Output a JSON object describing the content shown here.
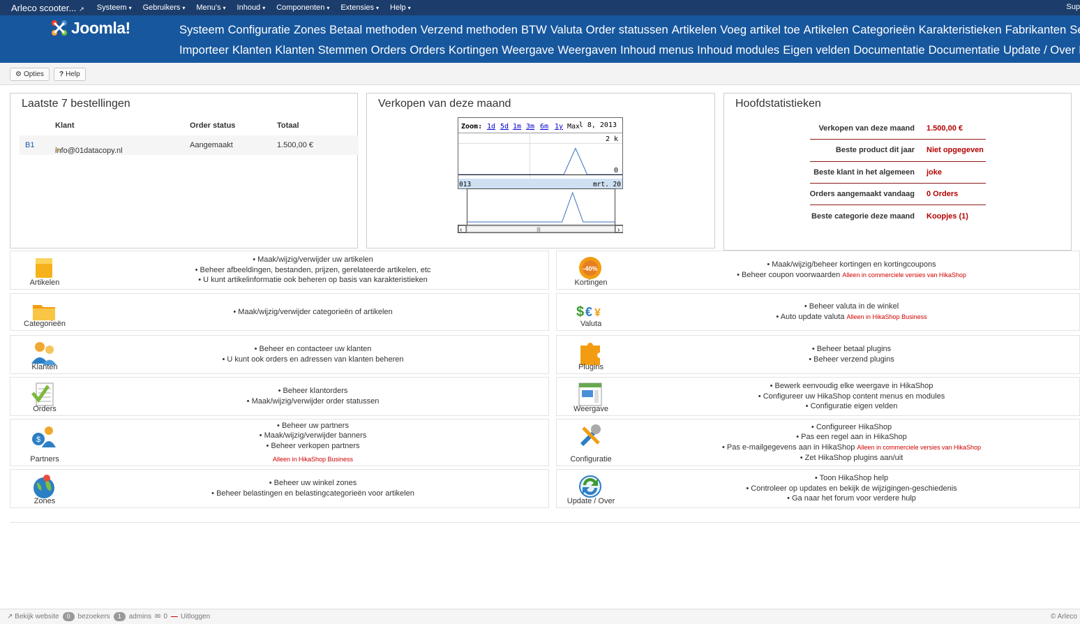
{
  "topbar": {
    "site_title": "Arleco scooter...",
    "menus": [
      "Systeem",
      "Gebruikers",
      "Menu's",
      "Inhoud",
      "Componenten",
      "Extensies",
      "Help"
    ],
    "right": "Sup"
  },
  "header": {
    "logo_text": "Joomla!",
    "nav_row1": [
      "Systeem",
      "Configuratie",
      "Zones",
      "Betaal methoden",
      "Verzend methoden",
      "BTW",
      "Valuta",
      "Order statussen",
      "Artikelen",
      "Voeg artikel toe",
      "Artikelen",
      "Categorieën",
      "Karakteristieken",
      "Fabrikanten",
      "Series"
    ],
    "nav_row2": [
      "Importeer",
      "Klanten",
      "Klanten",
      "Stemmen",
      "Orders",
      "Orders",
      "Kortingen",
      "Weergave",
      "Weergaven",
      "Inhoud menus",
      "Inhoud modules",
      "Eigen velden",
      "Documentatie",
      "Documentatie",
      "Update / Over",
      "Forum"
    ]
  },
  "toolbar": {
    "options": "Opties",
    "help": "Help"
  },
  "orders_panel": {
    "title": "Laatste 7 bestellingen",
    "columns": [
      "Klant",
      "Order status",
      "Totaal"
    ],
    "rows": [
      {
        "id": "B1",
        "customer": "info@01datacopy.nl",
        "status": "Aangemaakt",
        "total": "1.500,00 €"
      }
    ]
  },
  "sales_panel": {
    "title": "Verkopen van deze maand",
    "zoom_label": "Zoom:",
    "zoom_options": [
      "1d",
      "5d",
      "1m",
      "3m",
      "6m",
      "1y",
      "Max"
    ],
    "date_label": "l 8, 2013",
    "y_top": "2 k",
    "y_zero": "0",
    "range_left": "013",
    "range_right": "mrt. 20"
  },
  "chart_data": {
    "type": "line",
    "title": "",
    "ylim": [
      0,
      2000
    ],
    "note_values": "single spike near end of period",
    "series": [
      {
        "values": [
          0,
          0,
          0,
          0,
          0,
          0,
          0,
          0,
          0,
          0,
          1500,
          0,
          0,
          0,
          0
        ]
      }
    ]
  },
  "stats_panel": {
    "title": "Hoofdstatistieken",
    "rows": [
      {
        "label": "Verkopen van deze maand",
        "value": "1.500,00 €"
      },
      {
        "label": "Beste product dit jaar",
        "value": "Niet opgegeven"
      },
      {
        "label": "Beste klant in het algemeen",
        "value": "joke"
      },
      {
        "label": "Orders aangemaakt vandaag",
        "value": "0 Orders"
      },
      {
        "label": "Beste categorie deze maand",
        "value": "Koopjes (1)"
      }
    ]
  },
  "tiles_left": [
    {
      "label": "Artikelen",
      "lines": [
        "Maak/wijzig/verwijder uw artikelen",
        "Beheer afbeeldingen, bestanden, prijzen, gerelateerde artikelen, etc",
        "U kunt artikelinformatie ook beheren op basis van karakteristieken"
      ]
    },
    {
      "label": "Categorieën",
      "lines": [
        "Maak/wijzig/verwijder categorieën of artikelen"
      ]
    },
    {
      "label": "Klanten",
      "lines": [
        "Beheer en contacteer uw klanten",
        "U kunt ook orders en adressen van klanten beheren"
      ]
    },
    {
      "label": "Orders",
      "lines": [
        "Beheer klantorders",
        "Maak/wijzig/verwijder order statussen"
      ]
    },
    {
      "label": "Partners",
      "lines": [
        "Beheer uw partners",
        "Maak/wijzig/verwijder banners",
        "Beheer verkopen partners"
      ],
      "note": "Alleen in HikaShop Business"
    },
    {
      "label": "Zones",
      "lines": [
        "Beheer uw winkel zones",
        "Beheer belastingen en belastingcategorieën voor artikelen"
      ]
    }
  ],
  "tiles_right": [
    {
      "label": "Kortingen",
      "lines": [
        "Maak/wijzig/beheer kortingen en kortingcoupons",
        "Beheer coupon voorwaarden"
      ],
      "inline_notes": {
        "1": "Alleen in commerciele versies van HikaShop"
      }
    },
    {
      "label": "Valuta",
      "lines": [
        "Beheer valuta in de winkel",
        "Auto update valuta"
      ],
      "inline_notes": {
        "1": "Alleen in HikaShop Business"
      }
    },
    {
      "label": "Plugins",
      "lines": [
        "Beheer betaal plugins",
        "Beheer verzend plugins"
      ]
    },
    {
      "label": "Weergave",
      "lines": [
        "Bewerk eenvoudig elke weergave in HikaShop",
        "Configureer uw HikaShop content menus en modules",
        "Configuratie eigen velden"
      ]
    },
    {
      "label": "Configuratie",
      "lines": [
        "Configureer HikaShop",
        "Pas een regel aan in HikaShop",
        "Pas e-mailgegevens aan in HikaShop",
        "Zet HikaShop plugins aan/uit"
      ],
      "inline_notes": {
        "2": "Alleen in commerciele versies van HikaShop"
      }
    },
    {
      "label": "Update / Over",
      "lines": [
        "Toon HikaShop help",
        "Controleer op updates en bekijk de wijzigingen-geschiedenis",
        "Ga naar het forum voor verdere hulp"
      ]
    }
  ],
  "footer": {
    "view_site": "Bekijk website",
    "visitors_count": "0",
    "visitors": "bezoekers",
    "admins_count": "1",
    "admins": "admins",
    "messages_count": "0",
    "logout": "Uitloggen",
    "copyright": "© Arleco"
  },
  "colors": {
    "topbar": "#1c3d6b",
    "header": "#17579e",
    "accent_red": "#b30000"
  }
}
